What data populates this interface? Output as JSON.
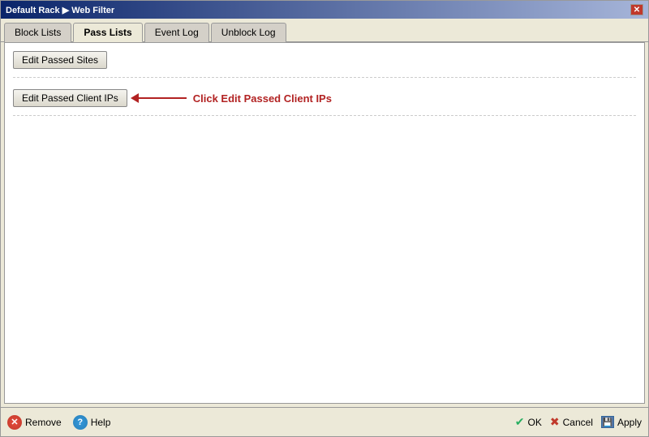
{
  "window": {
    "title": "Default Rack ▶ Web Filter",
    "close_label": "✕"
  },
  "tabs": [
    {
      "id": "block-lists",
      "label": "Block Lists",
      "active": false
    },
    {
      "id": "pass-lists",
      "label": "Pass Lists",
      "active": true
    },
    {
      "id": "event-log",
      "label": "Event Log",
      "active": false
    },
    {
      "id": "unblock-log",
      "label": "Unblock Log",
      "active": false
    }
  ],
  "content": {
    "edit_passed_sites_label": "Edit Passed Sites",
    "edit_passed_client_label": "Edit Passed Client IPs",
    "annotation_text": "Click Edit Passed Client IPs"
  },
  "bottom_bar": {
    "remove_label": "Remove",
    "help_label": "Help",
    "ok_label": "OK",
    "cancel_label": "Cancel",
    "apply_label": "Apply"
  }
}
